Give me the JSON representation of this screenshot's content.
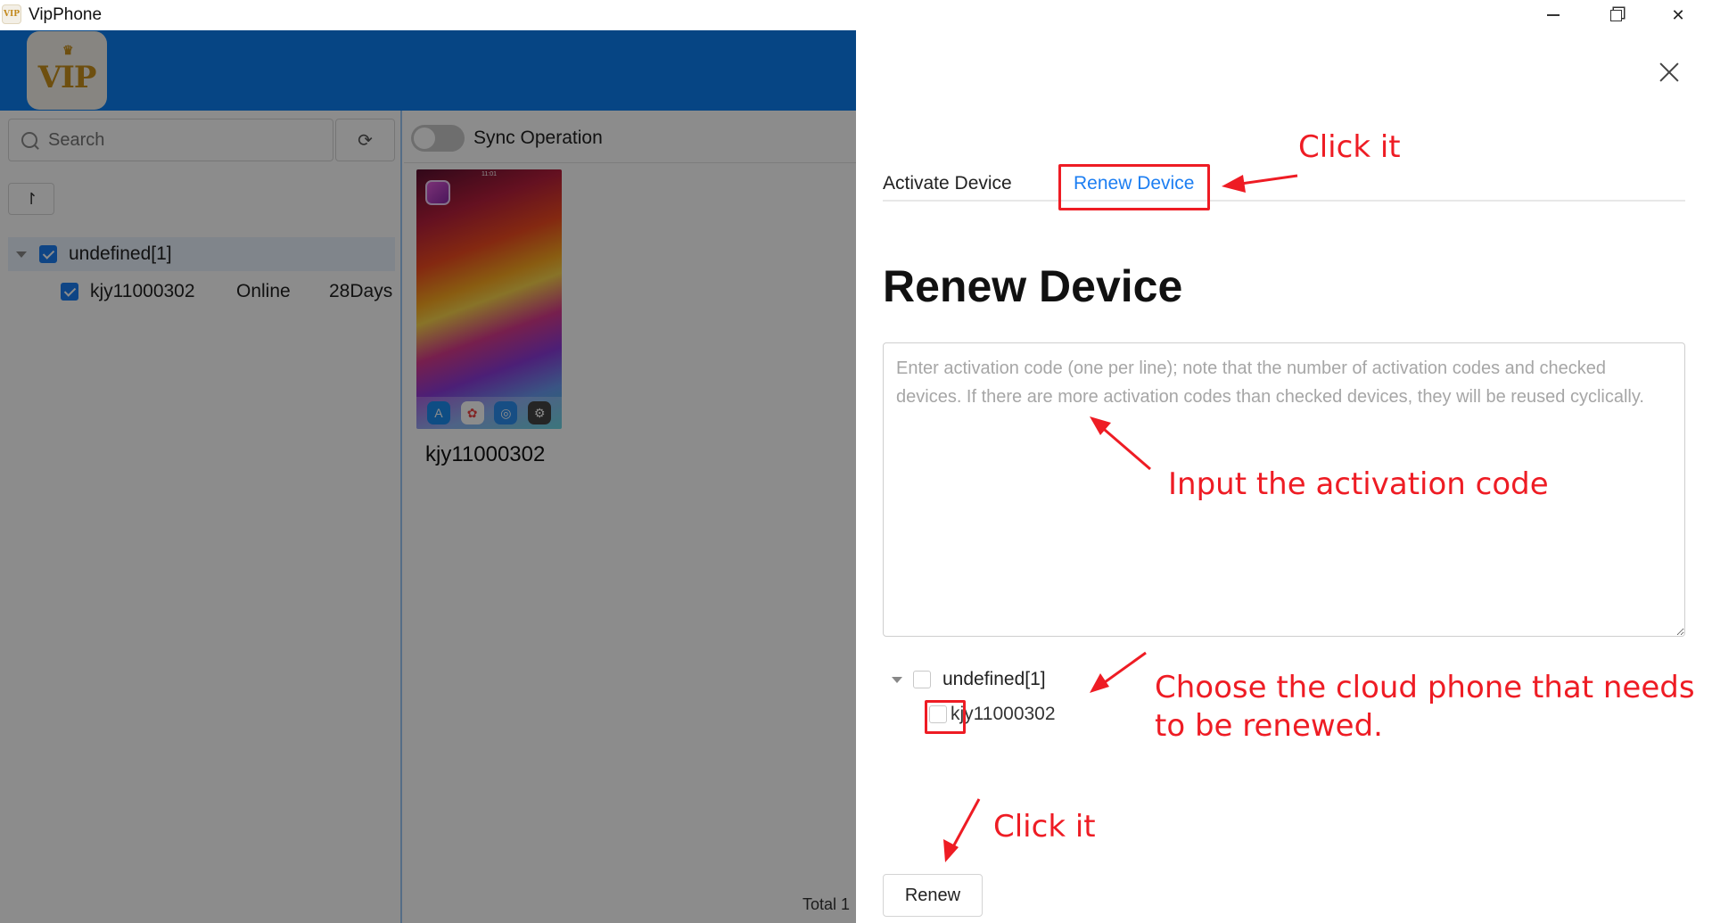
{
  "window": {
    "app_icon_text": "VIP",
    "title": "VipPhone"
  },
  "header": {
    "logo_text": "VIP",
    "logo_crown": "♛"
  },
  "sidebar": {
    "search_placeholder": "Search",
    "refresh_icon": "refresh-icon",
    "sort_label": "↾",
    "group": {
      "label": "undefined[1]",
      "checked": true
    },
    "devices": [
      {
        "name": "kjy11000302",
        "status": "Online",
        "remaining": "28Days",
        "checked": true
      }
    ]
  },
  "main": {
    "sync_label": "Sync Operation",
    "sync_enabled": false,
    "phones": [
      {
        "name": "kjy11000302",
        "screen_time": "11:01"
      }
    ],
    "total_label": "Total 1"
  },
  "drawer": {
    "tabs": [
      {
        "label": "Activate Device",
        "active": false
      },
      {
        "label": "Renew Device",
        "active": true
      }
    ],
    "title": "Renew Device",
    "textarea_placeholder": "Enter activation code (one per line); note that the number of activation codes and checked devices. If there are more activation codes than checked devices, they will be reused cyclically.",
    "tree": {
      "group": {
        "label": "undefined[1]",
        "checked": false
      },
      "devices": [
        {
          "name": "kjy11000302",
          "checked": false
        }
      ]
    },
    "renew_button": "Renew"
  },
  "annotations": {
    "click_tab": "Click it",
    "input_code": "Input the activation code",
    "choose_line1": "Choose the cloud phone that needs",
    "choose_line2": "to be renewed.",
    "click_renew": "Click it",
    "color": "#ee1c24"
  }
}
